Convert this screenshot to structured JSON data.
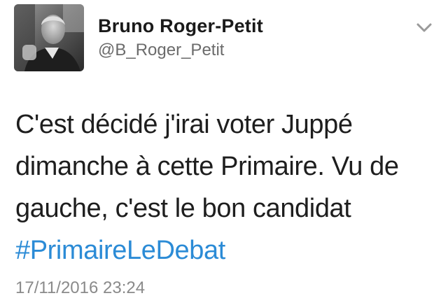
{
  "author": {
    "display_name": "Bruno Roger-Petit",
    "handle": "@B_Roger_Petit"
  },
  "tweet": {
    "line1": "C'est décidé j'irai voter Juppé",
    "line2": "dimanche à cette Primaire. Vu de",
    "line3": "gauche, c'est le bon candidat",
    "hashtag": "#PrimaireLeDebat",
    "timestamp": "17/11/2016 23:24"
  },
  "icons": {
    "menu": "chevron-down-icon"
  },
  "colors": {
    "link": "#2b8bd6",
    "handle": "#6b6b6b",
    "text": "#1e1e1e"
  }
}
